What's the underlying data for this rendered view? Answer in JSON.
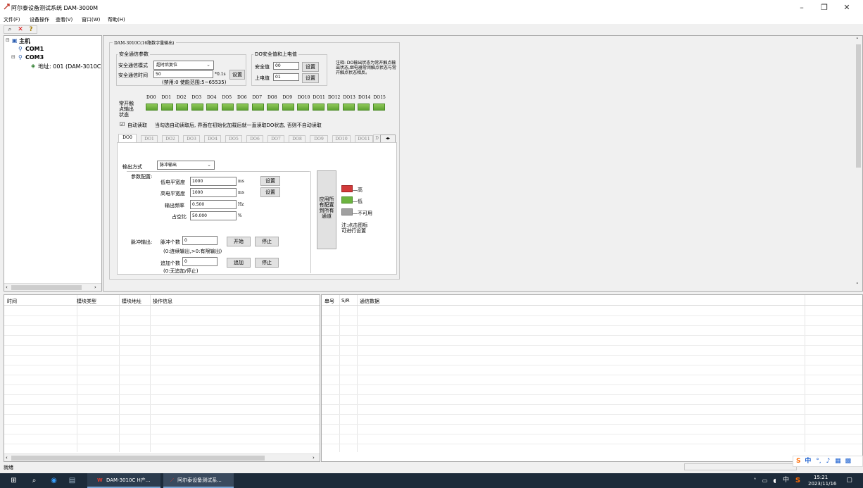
{
  "window": {
    "title": "阿尔泰设备测试系统 DAM-3000M",
    "minimize": "–",
    "maximize": "❐",
    "close": "✕"
  },
  "menu": {
    "file": "文件(F)",
    "device": "设备操作",
    "view": "查看(V)",
    "window": "窗口(W)",
    "help": "帮助(H)"
  },
  "toolbar": {
    "search_icon": "search-icon",
    "close_icon": "close-icon",
    "help_icon": "help-icon"
  },
  "tree": {
    "host": "主机",
    "com1": "COM1",
    "com3": "COM3",
    "address": "地址: 001 (DAM-3010C"
  },
  "panel": {
    "title": "DAM-3010C(16路数字量输出)",
    "safety_group": "安全通信参数",
    "safety_mode_label": "安全通信模式",
    "safety_mode_value": "超时后复位",
    "safety_time_label": "安全通信时间",
    "safety_time_value": "50",
    "safety_time_unit": "*0.1s",
    "set_button": "设置",
    "safety_time_hint": "(禁用:0 使能范围:5~65535)",
    "do_group": "DO安全值和上电值",
    "safe_value_label": "安全值",
    "safe_value": "00",
    "power_value_label": "上电值",
    "power_value": "01",
    "note": "注释: DO输出状态为常开触点输出状态,继电器常闭触点状态与常开触点状态相反。",
    "contact_label": "常开触点输出状态",
    "do_channels": [
      "DO0",
      "DO1",
      "DO2",
      "DO3",
      "DO4",
      "DO5",
      "DO6",
      "DO7",
      "DO8",
      "DO9",
      "DO10",
      "DO11",
      "DO12",
      "DO13",
      "DO14",
      "DO15"
    ],
    "auto_read_label": "自动读取",
    "auto_read_hint": "当勾选自动读取后, 界面在初始化加载后就一直读取DO状态, 否则不自动读取",
    "tabs": [
      "DO0",
      "DO1",
      "DO2",
      "DO3",
      "DO4",
      "DO5",
      "DO6",
      "DO7",
      "DO8",
      "DO9",
      "DO10",
      "DO11"
    ],
    "tab_cut": "D",
    "output_mode_label": "输出方式",
    "output_mode_value": "脉冲输出",
    "param_label": "参数配置:",
    "low_width_label": "低电平宽度",
    "low_width_value": "1000",
    "low_width_unit": "ms",
    "high_width_label": "高电平宽度",
    "high_width_value": "1000",
    "high_width_unit": "ms",
    "freq_label": "输出频率",
    "freq_value": " 0.500",
    "freq_unit": "Hz",
    "duty_label": "占空比",
    "duty_value": "50.000",
    "duty_unit": "%",
    "pulse_out_label": "脉冲输出:",
    "pulse_count_label": "脉冲个数",
    "pulse_count_value": "0",
    "start_button": "开始",
    "stop_button": "停止",
    "pulse_hint": "(0:连续输出,>0:有限输出)",
    "append_label": "追加个数",
    "append_value": "0",
    "append_button": "追加",
    "append_hint": "(0:无追加/停止)",
    "apply_all_button": "应用所有配置到所有通道",
    "legend_high": "—高",
    "legend_low": "—低",
    "legend_na": "—不可用",
    "legend_note": "注:点击图标可进行设置",
    "colors": {
      "high": "#d23a3a",
      "low": "#6cb33f",
      "na": "#a0a0a0"
    }
  },
  "log": {
    "columns": [
      "时间",
      "模块类型",
      "模块地址",
      "操作信息"
    ]
  },
  "data": {
    "columns": [
      "串号",
      "S/R",
      "通信数据"
    ]
  },
  "status": {
    "text": "就绪"
  },
  "taskbar": {
    "app1": "DAM-3010C H产...",
    "app2": "阿尔泰设备测试系...",
    "time": "15:21",
    "date": "2023/11/16",
    "ime": "中",
    "tray_ime": "中"
  }
}
